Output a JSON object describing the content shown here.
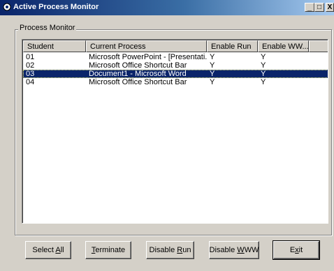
{
  "window": {
    "title": "Active Process Monitor",
    "minimize_glyph": "_",
    "maximize_glyph": "□",
    "close_glyph": "X"
  },
  "group": {
    "label": "Process Monitor"
  },
  "list": {
    "columns": [
      "Student",
      "Current Process",
      "Enable Run",
      "Enable WW..."
    ],
    "rows": [
      {
        "student": "01",
        "process": "Microsoft PowerPoint - [Presentati...",
        "enable_run": "Y",
        "enable_www": "Y",
        "selected": false
      },
      {
        "student": "02",
        "process": "Microsoft Office Shortcut Bar",
        "enable_run": "Y",
        "enable_www": "Y",
        "selected": false
      },
      {
        "student": "03",
        "process": "Document1 - Microsoft Word",
        "enable_run": "Y",
        "enable_www": "Y",
        "selected": true
      },
      {
        "student": "04",
        "process": "Microsoft Office Shortcut Bar",
        "enable_run": "Y",
        "enable_www": "Y",
        "selected": false
      }
    ]
  },
  "buttons": {
    "select_all": {
      "pre": "Select ",
      "mn": "A",
      "post": "ll"
    },
    "terminate": {
      "pre": "",
      "mn": "T",
      "post": "erminate"
    },
    "disable_run": {
      "pre": "Disable ",
      "mn": "R",
      "post": "un"
    },
    "disable_www": {
      "pre": "Disable ",
      "mn": "W",
      "post": "WW"
    },
    "exit": {
      "pre": "E",
      "mn": "x",
      "post": "it"
    }
  },
  "colors": {
    "selection": "#0a246a",
    "face": "#d4d0c8",
    "title_start": "#0a246a"
  }
}
